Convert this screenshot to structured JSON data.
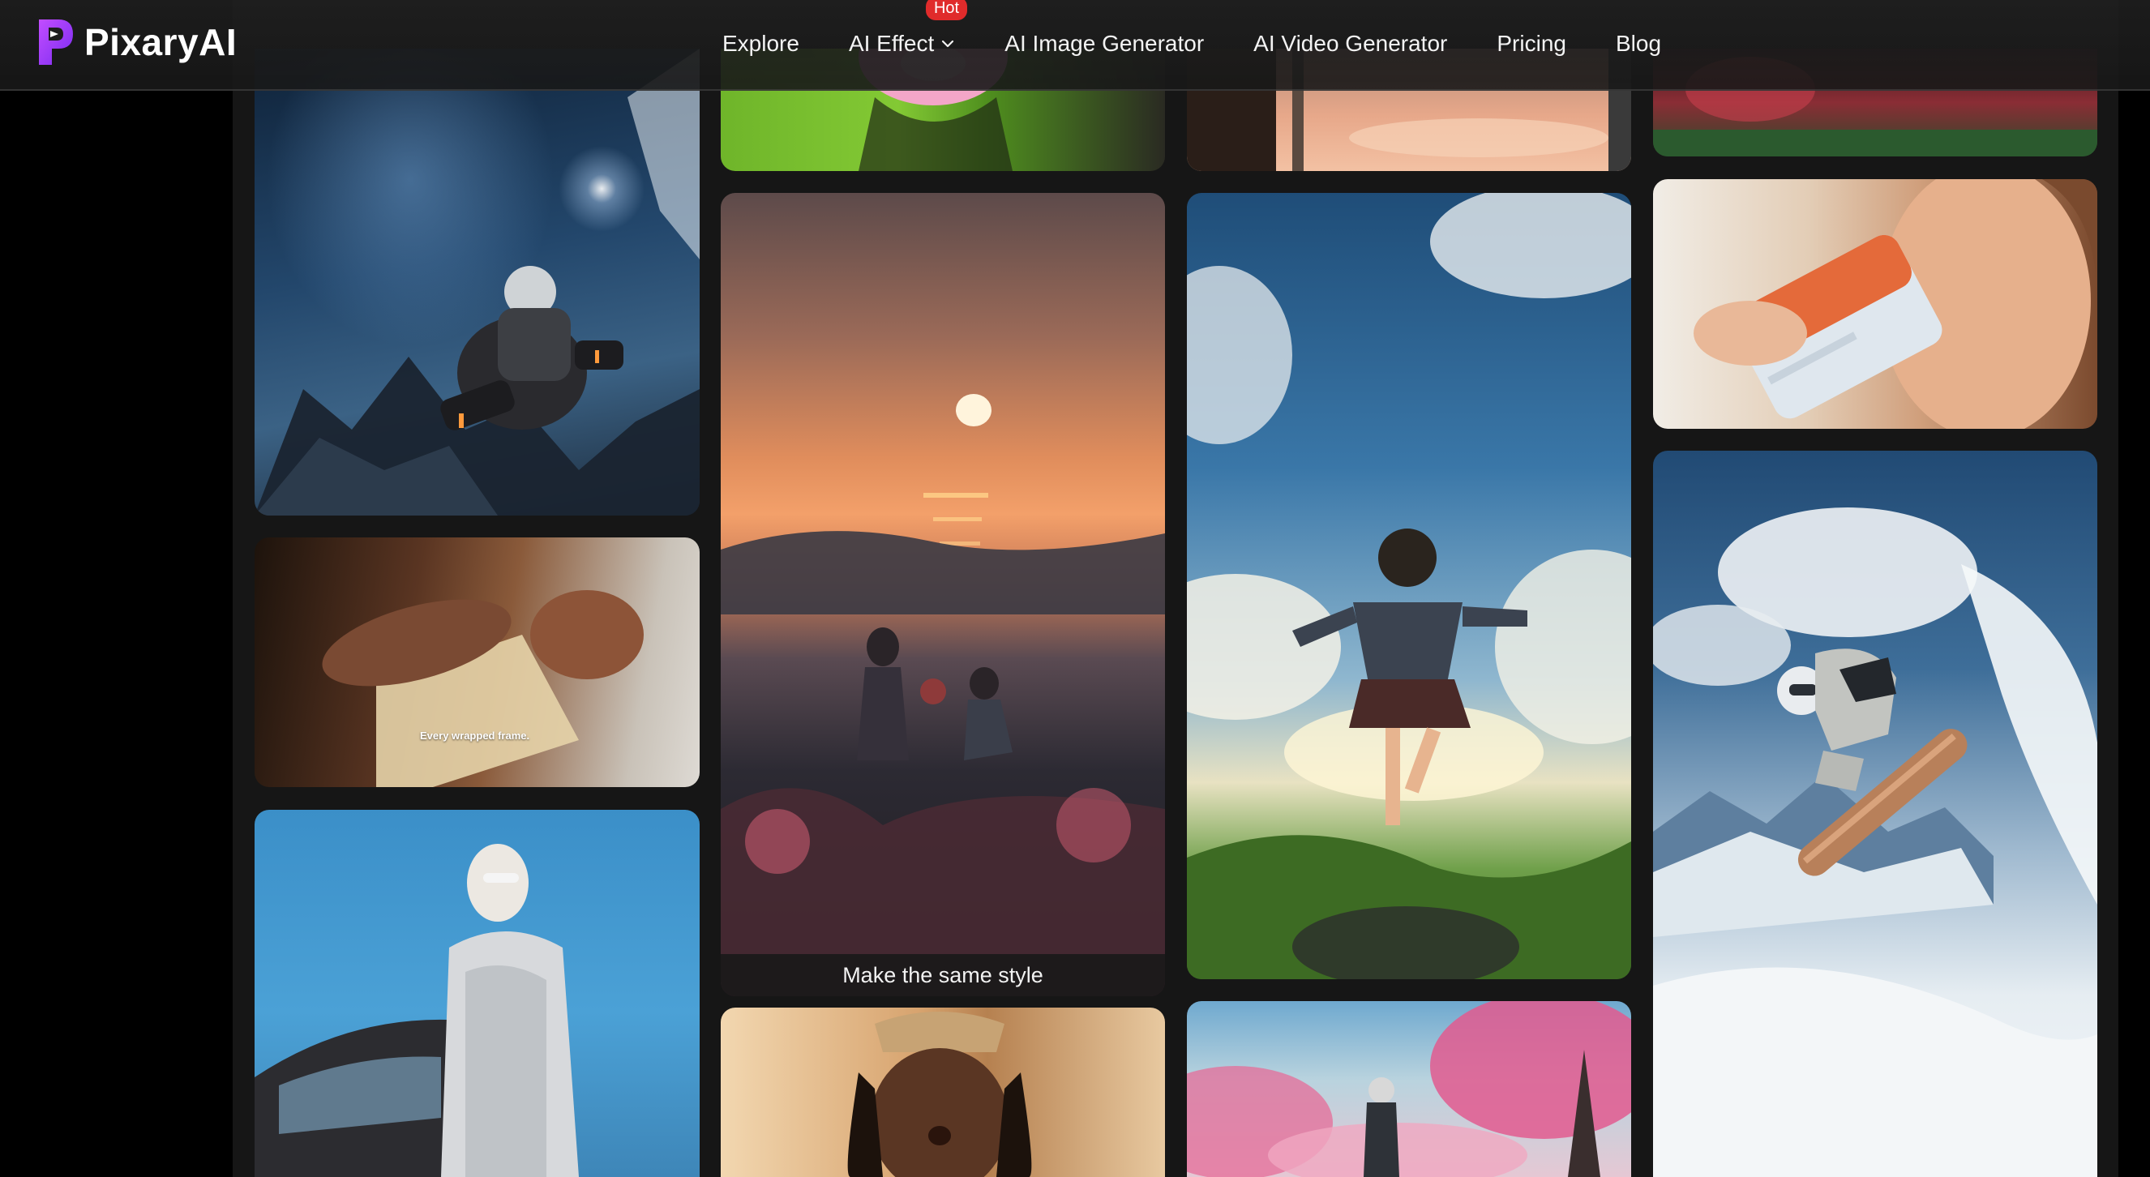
{
  "brand": {
    "name": "PixaryAI",
    "accent": "#a24df5"
  },
  "nav": {
    "items": [
      {
        "label": "Explore"
      },
      {
        "label": "AI Effect",
        "badge": "Hot",
        "icon": "chevron-down-icon"
      },
      {
        "label": "AI Image Generator"
      },
      {
        "label": "AI Video Generator"
      },
      {
        "label": "Pricing"
      },
      {
        "label": "Blog"
      }
    ]
  },
  "gallery": {
    "hover_caption": "Make the same style",
    "overlay_text": "Every wrapped frame."
  }
}
